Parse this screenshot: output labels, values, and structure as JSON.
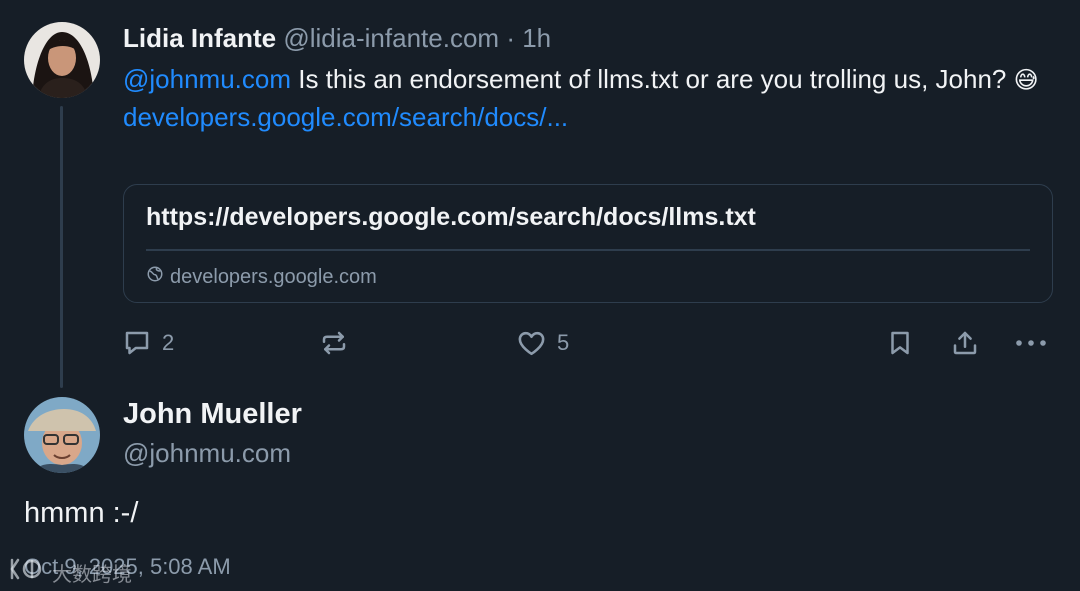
{
  "reply": {
    "author_name": "Lidia Infante",
    "author_handle": "@lidia-infante.com",
    "separator": "·",
    "time": "1h",
    "mention": "@johnmu.com",
    "text": " Is this an endorsement of llms.txt or are you trolling us, John? ",
    "emoji": "😅",
    "link": "developers.google.com/search/docs/...",
    "embed": {
      "title": "https://developers.google.com/search/docs/llms.txt",
      "domain": "developers.google.com",
      "domain_icon": "globe-icon"
    },
    "actions": {
      "reply_count": "2",
      "repost_count": "",
      "like_count": "5"
    }
  },
  "post": {
    "author_name": "John Mueller",
    "author_handle": "@johnmu.com",
    "text": "hmmn :-/",
    "timestamp": "Oct 9, 2025, 5:08 AM"
  },
  "watermark": {
    "text": "大数跨境",
    "logo": "watermark-logo-icon"
  },
  "colors": {
    "background": "#161e27",
    "text": "#f1f3f5",
    "muted": "#8c9bab",
    "link": "#208bfe",
    "border": "#2e3d4d"
  }
}
